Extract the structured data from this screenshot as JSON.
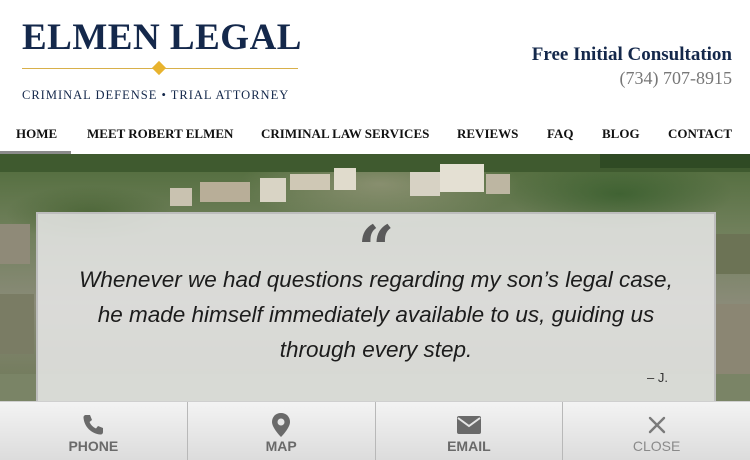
{
  "header": {
    "logo_name": "ELMEN LEGAL",
    "logo_tagline": "CRIMINAL DEFENSE • TRIAL ATTORNEY",
    "consult_title": "Free Initial Consultation",
    "consult_phone": "(734) 707-8915"
  },
  "nav": {
    "items": [
      {
        "label": "HOME",
        "active": true
      },
      {
        "label": "MEET ROBERT ELMEN"
      },
      {
        "label": "CRIMINAL LAW SERVICES"
      },
      {
        "label": "REVIEWS"
      },
      {
        "label": "FAQ"
      },
      {
        "label": "BLOG"
      },
      {
        "label": "CONTACT"
      }
    ]
  },
  "testimonial": {
    "quote_icon": "quote-mark-icon",
    "quote_mark": "“",
    "text": "Whenever we had questions regarding my son’s legal case, he made himself immediately available to us, guiding us through every step.",
    "author": "– J."
  },
  "bottom_bar": {
    "items": [
      {
        "label": "PHONE",
        "icon": "phone-icon"
      },
      {
        "label": "MAP",
        "icon": "map-pin-icon"
      },
      {
        "label": "EMAIL",
        "icon": "envelope-icon"
      },
      {
        "label": "CLOSE",
        "icon": "close-icon"
      }
    ]
  },
  "colors": {
    "brand_navy": "#14284b",
    "accent_gold": "#e8b32e",
    "bar_text": "#6a6a6a"
  }
}
